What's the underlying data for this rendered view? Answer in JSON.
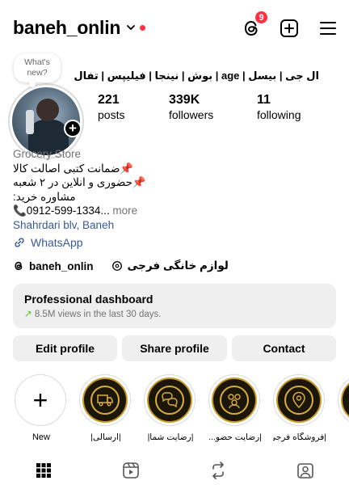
{
  "header": {
    "username": "baneh_onlin",
    "threads_badge": "9"
  },
  "profile": {
    "note_text": "What's new?",
    "full_name": "بوش | نینجا | فیلیپس | تفال | age | ال جی | بیسل",
    "stats": [
      {
        "num": "221",
        "label": "posts"
      },
      {
        "num": "339K",
        "label": "followers"
      },
      {
        "num": "11",
        "label": "following"
      }
    ],
    "bio": {
      "category": "Grocery Store",
      "line1": "📌ضمانت کتبی اصالت کالا",
      "line2": "📌حضوری و انلاین در ۲ شعبه",
      "line3": "مشاوره خرید:",
      "line4_phone": "📞0912-599-1334...",
      "more": " more",
      "location": "Shahrdari blv, Baneh"
    },
    "link_label": "WhatsApp",
    "threads_handle": "baneh_onlin",
    "secondary_handle": "لوازم خانگی فرجی"
  },
  "dashboard": {
    "title": "Professional dashboard",
    "subtitle": "8.5M views in the last 30 days."
  },
  "buttons": {
    "edit": "Edit profile",
    "share": "Share profile",
    "contact": "Contact"
  },
  "highlights": [
    {
      "label": "New",
      "icon": "plus-icon"
    },
    {
      "label": "|ارسالی|",
      "icon": "delivery-truck-icon"
    },
    {
      "label": "|رضایت شما|",
      "icon": "chat-bubbles-icon"
    },
    {
      "label": "|رضایت حضو...",
      "icon": "people-icon"
    },
    {
      "label": "|فروشگاه فرجی|",
      "icon": "location-pin-icon"
    }
  ],
  "colors": {
    "accent_red": "#ff3040",
    "link_blue": "#385898",
    "gold": "#c99c2a"
  }
}
